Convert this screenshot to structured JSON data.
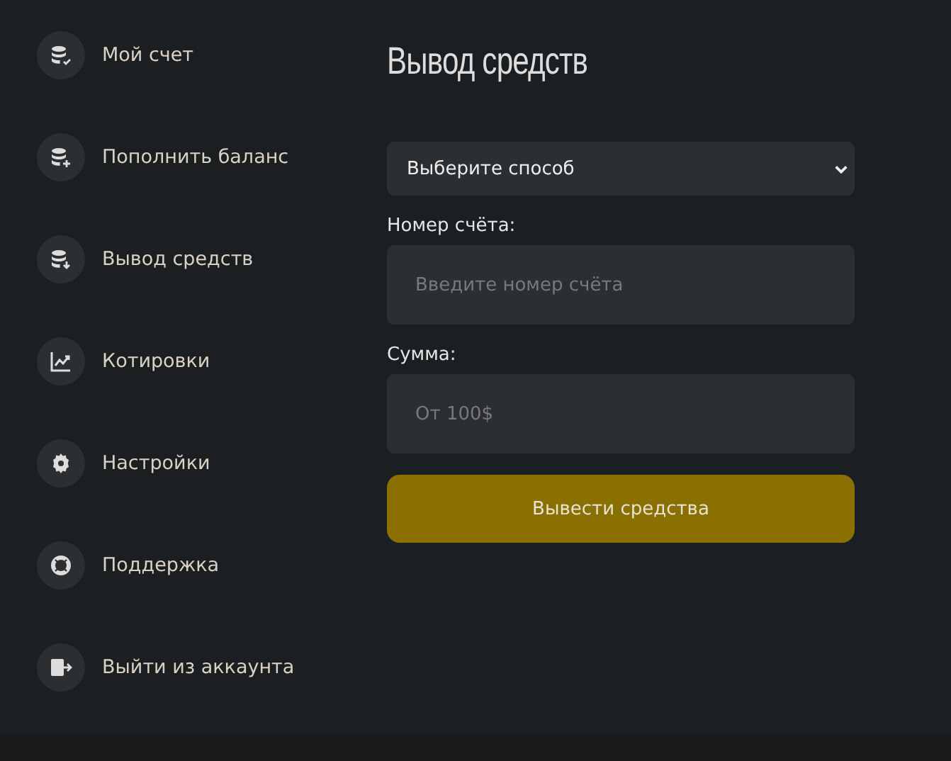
{
  "sidebar": {
    "items": [
      {
        "label": "Мой счет",
        "kind": "coins-check"
      },
      {
        "label": "Пополнить баланс",
        "kind": "coins-plus"
      },
      {
        "label": "Вывод средств",
        "kind": "coins-down"
      },
      {
        "label": "Котировки",
        "kind": "chart"
      },
      {
        "label": "Настройки",
        "kind": "gear"
      },
      {
        "label": "Поддержка",
        "kind": "lifebuoy"
      },
      {
        "label": "Выйти из аккаунта",
        "kind": "exit"
      }
    ]
  },
  "form": {
    "title": "Вывод средств",
    "method_select": {
      "value": "Выберите способ"
    },
    "fields": [
      {
        "label": "Номер счёта:",
        "placeholder": "Введите номер счёта"
      },
      {
        "label": "Сумма:",
        "placeholder": "От 100$"
      }
    ],
    "submit": "Вывести средства"
  }
}
